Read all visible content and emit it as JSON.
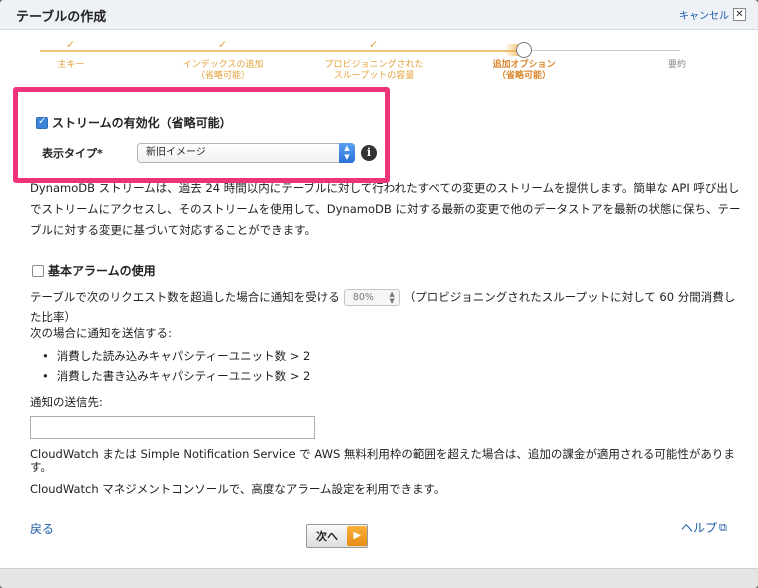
{
  "dialog": {
    "title": "テーブルの作成",
    "cancel_label": "キャンセル",
    "close_glyph": "✕"
  },
  "wizard": {
    "steps": [
      {
        "label": "主キー",
        "state": "done"
      },
      {
        "label": "インデックスの追加\n（省略可能）",
        "state": "done"
      },
      {
        "label": "プロビジョニングされた\nスループットの容量",
        "state": "done"
      },
      {
        "label": "追加オプション\n（省略可能）",
        "state": "current"
      },
      {
        "label": "要約",
        "state": "todo"
      }
    ]
  },
  "stream": {
    "checkbox_checked": true,
    "label": "ストリームの有効化（省略可能）",
    "view_type_label": "表示タイプ*",
    "view_type_value": "新旧イメージ",
    "info_icon": "i"
  },
  "description": "DynamoDB ストリームは、過去 24 時間以内にテーブルに対して行われたすべての変更のストリームを提供します。簡単な API 呼び出しでストリームにアクセスし、そのストリームを使用して、DynamoDB に対する最新の変更で他のデータストアを最新の状態に保ち、テーブルに対する変更に基づいて対応することができます。",
  "alarm": {
    "checkbox_checked": false,
    "label": "基本アラームの使用",
    "threshold_prefix": "テーブルで次のリクエスト数を超過した場合に通知を受ける",
    "threshold_value": "80%",
    "threshold_suffix": "（プロビジョニングされたスループットに対して 60 分間消費した比率）",
    "notify_heading": "次の場合に通知を送信する:",
    "conditions": [
      "消費した読み込みキャパシティーユニット数 > 2",
      "消費した書き込みキャパシティーユニット数 > 2"
    ],
    "destination_label": "通知の送信先:",
    "destination_value": ""
  },
  "notes": {
    "cost": "CloudWatch または Simple Notification Service で AWS 無料利用枠の範囲を超えた場合は、追加の課金が適用される可能性があります。",
    "console": "CloudWatch マネジメントコンソールで、高度なアラーム設定を利用できます。"
  },
  "footer": {
    "back_label": "戻る",
    "next_label": "次へ",
    "help_label": "ヘルプ"
  },
  "colors": {
    "highlight": "#f0327a",
    "step_done": "#e3a23a",
    "link": "#1a5aa8",
    "next_arrow": "#f0a020"
  }
}
